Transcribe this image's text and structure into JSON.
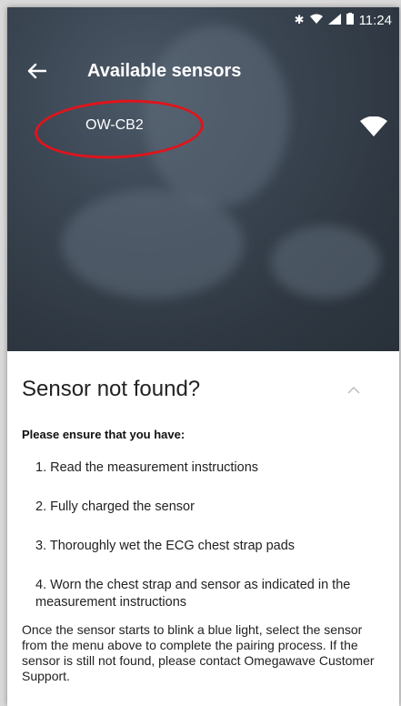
{
  "status_bar": {
    "time": "11:24",
    "icons": [
      "bluetooth-icon",
      "wifi-icon",
      "signal-icon",
      "battery-icon"
    ]
  },
  "app_bar": {
    "title": "Available sensors",
    "back_icon": "arrow-left-icon"
  },
  "sensors": [
    {
      "name": "OW-CB2",
      "signal_icon": "wifi-signal-icon"
    }
  ],
  "help": {
    "title": "Sensor not found?",
    "intro": "Please ensure that you have:",
    "steps": [
      "1. Read the measurement instructions",
      "2. Fully charged the sensor",
      "3. Thoroughly wet the ECG chest strap pads",
      "4. Worn the chest strap and sensor as indicated in the measurement instructions"
    ],
    "footer": "Once the sensor starts to blink a blue light, select the sensor from the menu above to complete the pairing process. If the sensor is still not found, please contact Omegawave Customer Support."
  },
  "colors": {
    "hero_bg": "#2f3842",
    "annotation_circle": "#e0141b",
    "sheet_bg": "#ffffff"
  }
}
